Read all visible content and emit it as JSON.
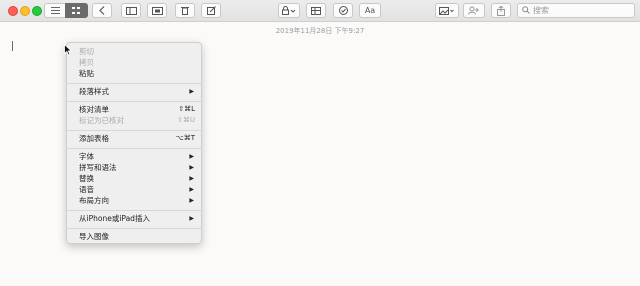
{
  "toolbar": {
    "search_placeholder": "搜索",
    "format_label": "Aa"
  },
  "note": {
    "date": "2019年11月28日 下午9:27"
  },
  "menu": {
    "cut": "剪切",
    "copy": "拷贝",
    "paste": "粘贴",
    "paragraph_style": "段落样式",
    "checklist": "核对清单",
    "checklist_shortcut": "⇧⌘L",
    "mark_checked": "标记为已核对",
    "mark_checked_shortcut": "⇧⌘U",
    "add_table": "添加表格",
    "add_table_shortcut": "⌥⌘T",
    "font": "字体",
    "spelling": "拼写和语法",
    "substitutions": "替换",
    "speech": "语音",
    "layout_direction": "布局方向",
    "insert_from_iphone": "从iPhone或iPad插入",
    "import_image": "导入图像",
    "submenu_arrow": "▶"
  }
}
